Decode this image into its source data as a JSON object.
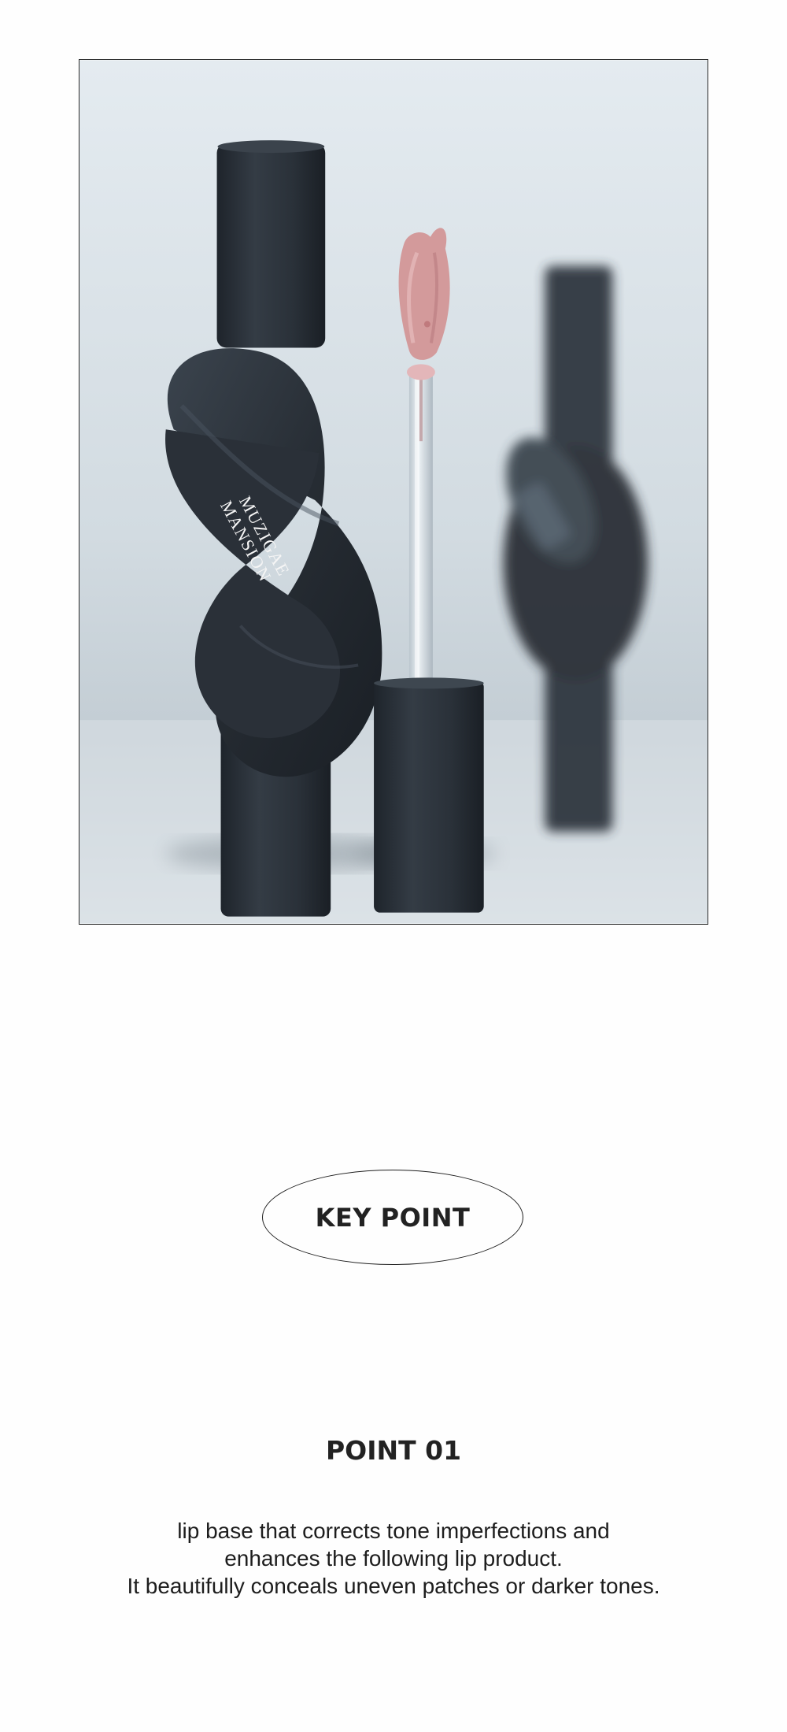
{
  "hero": {
    "brand_line1": "MUZIGAE",
    "brand_line2": "MANSION"
  },
  "key_point": {
    "label": "KEY POINT"
  },
  "point": {
    "title": "POINT 01",
    "lines": [
      "lip base that corrects tone imperfections and",
      "enhances the following lip product.",
      "It beautifully conceals uneven patches or darker tones."
    ]
  },
  "colors": {
    "background": "#fefefe",
    "text": "#1d1d1d",
    "tube": "#2b323a",
    "tint": "#d39a9b"
  }
}
